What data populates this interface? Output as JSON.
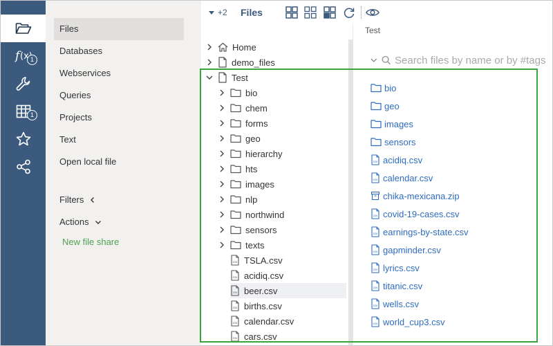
{
  "rail": {
    "items": [
      {
        "icon": "folder-open-icon",
        "active": true
      },
      {
        "icon": "function-icon",
        "badge": "1"
      },
      {
        "icon": "wrench-icon"
      },
      {
        "icon": "table-icon",
        "badge": "1"
      },
      {
        "icon": "star-icon"
      },
      {
        "icon": "share-icon"
      }
    ]
  },
  "nav": {
    "items": [
      "Files",
      "Databases",
      "Webservices",
      "Queries",
      "Projects",
      "Text",
      "Open local file"
    ],
    "filters_label": "Filters",
    "actions_label": "Actions",
    "new_file_share": "New file share"
  },
  "toolbar": {
    "count": "+2",
    "title": "Files"
  },
  "breadcrumb": "Test",
  "search": {
    "placeholder": "Search files by name or by #tags"
  },
  "tree": {
    "rows": [
      {
        "label": "Home",
        "type": "home",
        "chevron": "right",
        "indent": 0
      },
      {
        "label": "demo_files",
        "type": "doc",
        "chevron": "right",
        "indent": 0
      },
      {
        "label": "Test",
        "type": "doc",
        "chevron": "down",
        "indent": 0
      },
      {
        "label": "bio",
        "type": "folder",
        "chevron": "right",
        "indent": 1
      },
      {
        "label": "chem",
        "type": "folder",
        "chevron": "right",
        "indent": 1
      },
      {
        "label": "forms",
        "type": "folder",
        "chevron": "right",
        "indent": 1
      },
      {
        "label": "geo",
        "type": "folder",
        "chevron": "right",
        "indent": 1
      },
      {
        "label": "hierarchy",
        "type": "folder",
        "chevron": "right",
        "indent": 1
      },
      {
        "label": "hts",
        "type": "folder",
        "chevron": "right",
        "indent": 1
      },
      {
        "label": "images",
        "type": "folder",
        "chevron": "right",
        "indent": 1
      },
      {
        "label": "nlp",
        "type": "folder",
        "chevron": "right",
        "indent": 1
      },
      {
        "label": "northwind",
        "type": "folder",
        "chevron": "right",
        "indent": 1
      },
      {
        "label": "sensors",
        "type": "folder",
        "chevron": "right",
        "indent": 1
      },
      {
        "label": "texts",
        "type": "folder",
        "chevron": "right",
        "indent": 1
      },
      {
        "label": "TSLA.csv",
        "type": "csv",
        "indent": 1
      },
      {
        "label": "acidiq.csv",
        "type": "csv",
        "indent": 1
      },
      {
        "label": "beer.csv",
        "type": "csv",
        "indent": 1,
        "selected": true
      },
      {
        "label": "births.csv",
        "type": "csv",
        "indent": 1
      },
      {
        "label": "calendar.csv",
        "type": "csv",
        "indent": 1
      },
      {
        "label": "cars.csv",
        "type": "csv",
        "indent": 1
      }
    ]
  },
  "files": [
    {
      "label": "bio",
      "type": "folder"
    },
    {
      "label": "geo",
      "type": "folder"
    },
    {
      "label": "images",
      "type": "folder"
    },
    {
      "label": "sensors",
      "type": "folder"
    },
    {
      "label": "acidiq.csv",
      "type": "csv"
    },
    {
      "label": "calendar.csv",
      "type": "csv"
    },
    {
      "label": "chika-mexicana.zip",
      "type": "zip"
    },
    {
      "label": "covid-19-cases.csv",
      "type": "csv"
    },
    {
      "label": "earnings-by-state.csv",
      "type": "csv"
    },
    {
      "label": "gapminder.csv",
      "type": "csv"
    },
    {
      "label": "lyrics.csv",
      "type": "csv"
    },
    {
      "label": "titanic.csv",
      "type": "csv"
    },
    {
      "label": "wells.csv",
      "type": "csv"
    },
    {
      "label": "world_cup3.csv",
      "type": "csv"
    }
  ],
  "colors": {
    "rail_bg": "#3c5a7e",
    "link_blue": "#2e6cbf",
    "accent_green": "#3aa43a"
  }
}
